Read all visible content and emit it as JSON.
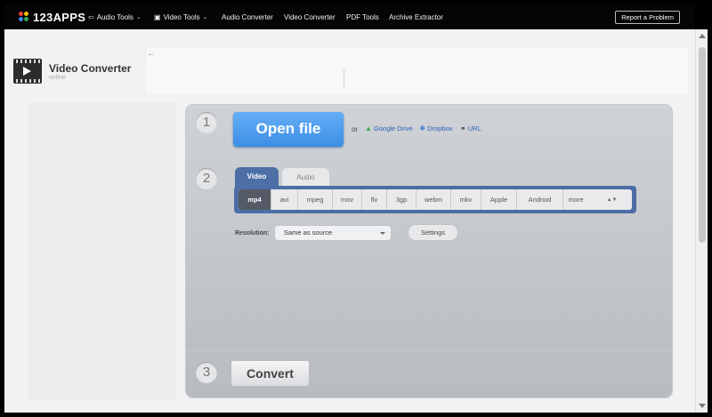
{
  "topnav": {
    "logo": "123APPS",
    "items": [
      {
        "label": "Audio Tools",
        "icon": "audio-wave-icon",
        "has_dropdown": true
      },
      {
        "label": "Video Tools",
        "icon": "video-play-icon",
        "has_dropdown": true
      },
      {
        "label": "Audio Converter"
      },
      {
        "label": "Video Converter"
      },
      {
        "label": "PDF Tools"
      },
      {
        "label": "Archive Extractor"
      }
    ],
    "report_label": "Report a Problem"
  },
  "app": {
    "title": "Video Converter",
    "subtitle": "online",
    "back_arrow": "←"
  },
  "step1": {
    "number": "1",
    "open_file": "Open file",
    "or": "or",
    "sources": [
      {
        "label": "Google Drive",
        "icon": "google-drive-icon",
        "color": "#34a853"
      },
      {
        "label": "Dropbox",
        "icon": "dropbox-icon",
        "color": "#2b6fd6"
      },
      {
        "label": "URL",
        "icon": "link-icon",
        "color": "#333333"
      }
    ]
  },
  "step2": {
    "number": "2",
    "tabs": [
      {
        "label": "Video",
        "active": true
      },
      {
        "label": "Audio",
        "active": false
      }
    ],
    "formats": [
      "mp4",
      "avi",
      "mpeg",
      "mov",
      "flv",
      "3gp",
      "webm",
      "mkv",
      "Apple",
      "Android",
      "more"
    ],
    "selected_format": "mp4",
    "resolution_label": "Resolution:",
    "resolution_value": "Same as source",
    "settings_label": "Settings"
  },
  "step3": {
    "number": "3",
    "convert_label": "Convert"
  },
  "colors": {
    "accent_blue": "#4b6ea6",
    "open_button": "#4d9af0",
    "nav_bg": "#050505"
  }
}
